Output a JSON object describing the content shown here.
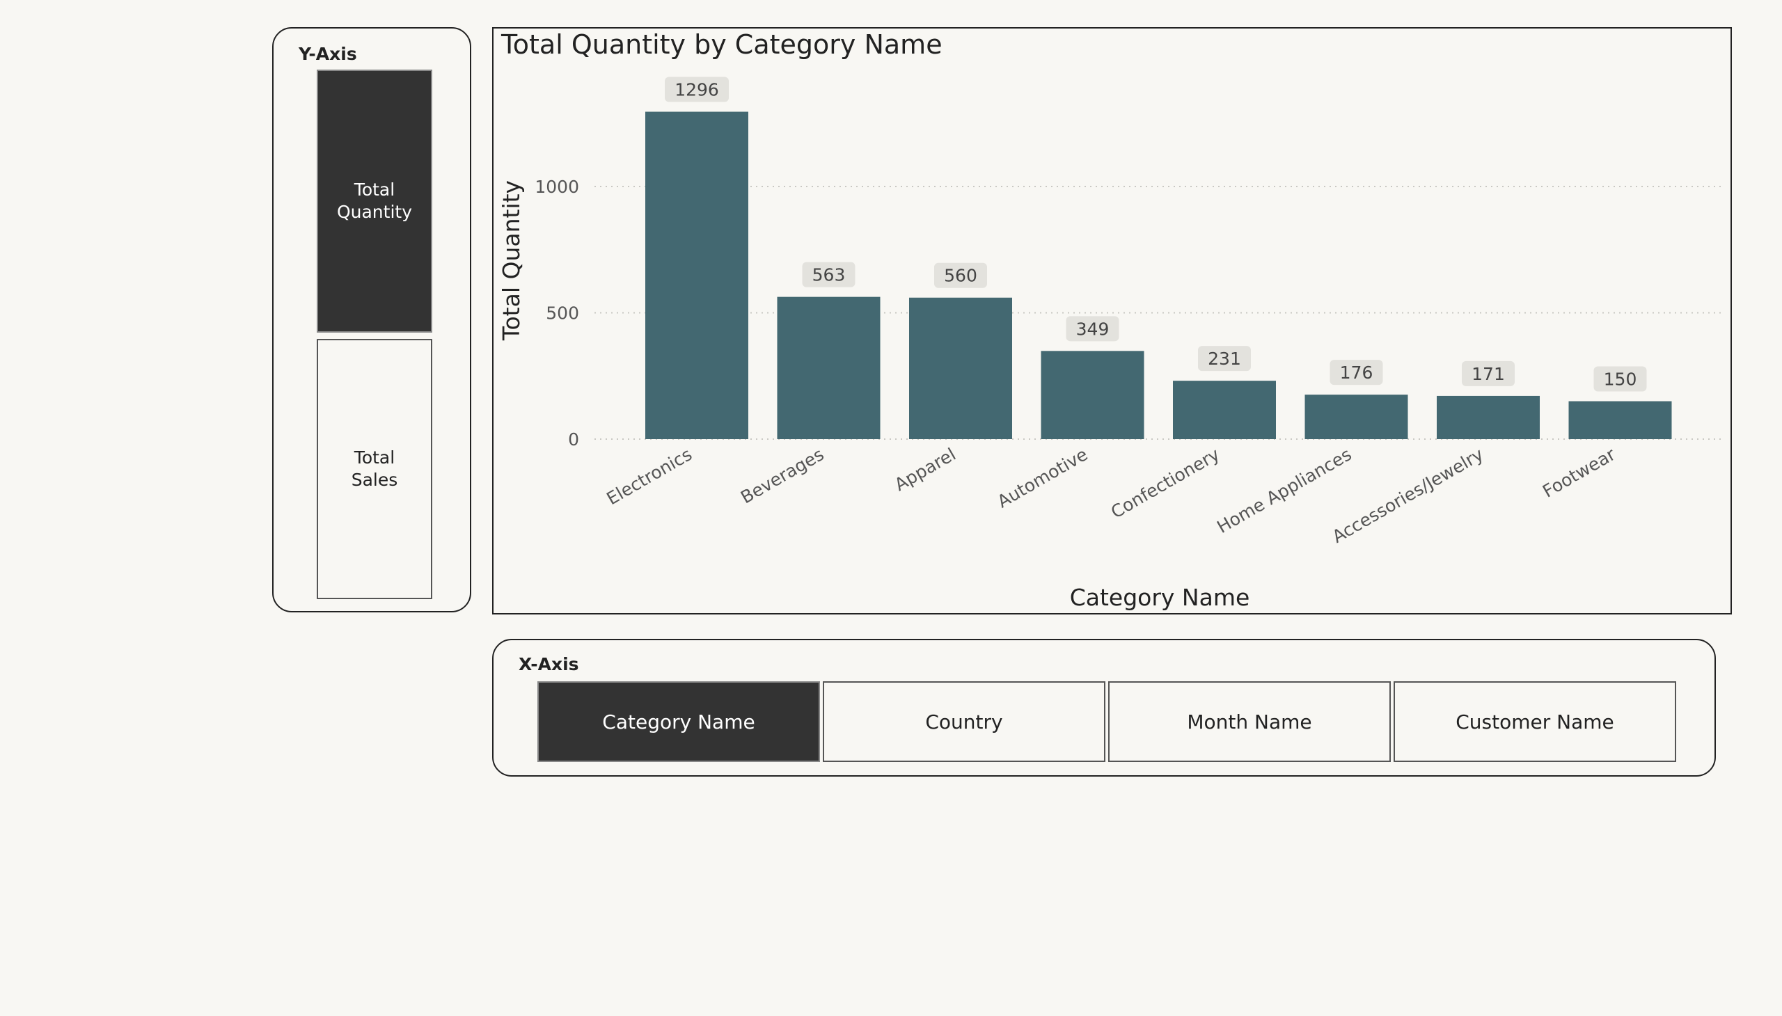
{
  "y_axis_slicer": {
    "title": "Y-Axis",
    "options": [
      {
        "label": "Total\nQuantity",
        "selected": true
      },
      {
        "label": "Total\nSales",
        "selected": false
      }
    ]
  },
  "x_axis_slicer": {
    "title": "X-Axis",
    "options": [
      {
        "label": "Category Name",
        "selected": true
      },
      {
        "label": "Country",
        "selected": false
      },
      {
        "label": "Month Name",
        "selected": false
      },
      {
        "label": "Customer Name",
        "selected": false
      }
    ]
  },
  "colors": {
    "bar": "#436871",
    "label_bg": "#e3e2dd",
    "selected_bg": "#333333",
    "background": "#f8f7f3"
  },
  "chart_data": {
    "type": "bar",
    "title": "Total Quantity by Category Name",
    "xlabel": "Category Name",
    "ylabel": "Total Quantity",
    "categories": [
      "Electronics",
      "Beverages",
      "Apparel",
      "Automotive",
      "Confectionery",
      "Home Appliances",
      "Accessories/Jewelry",
      "Footwear"
    ],
    "values": [
      1296,
      563,
      560,
      349,
      231,
      176,
      171,
      150
    ],
    "data_labels": [
      "1296",
      "563",
      "560",
      "349",
      "231",
      "176",
      "171",
      "150"
    ],
    "yticks": [
      "0",
      "500",
      "1000"
    ],
    "ylim": [
      0,
      1300
    ],
    "grid": "horizontal dotted",
    "legend": "none"
  }
}
